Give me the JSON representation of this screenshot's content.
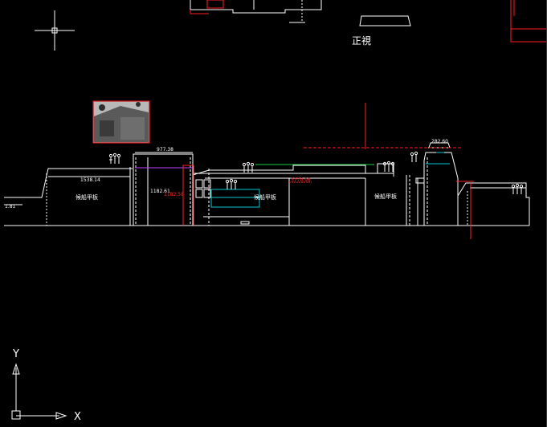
{
  "drawing": {
    "view_title": "正視",
    "dimensions": {
      "left_platform_width": "1538.14",
      "left_tower_width": "977.38",
      "left_tower_height": "1182.61",
      "red_vertical": "1182.58",
      "center_span": "3770.98",
      "right_tower_width": "282.60",
      "left_edge_label": "1.81"
    },
    "hall_labels": [
      "候船甲板",
      "候船甲板",
      "候船甲板"
    ],
    "colors": {
      "background": "#000000",
      "lines": "#ffffff",
      "red": "#ff2020",
      "cyan": "#00c8d0",
      "green": "#19d04a",
      "magenta": "#c040ff"
    }
  },
  "ucs": {
    "x_label": "X",
    "y_label": "Y"
  },
  "reference_image": {
    "description": ""
  }
}
